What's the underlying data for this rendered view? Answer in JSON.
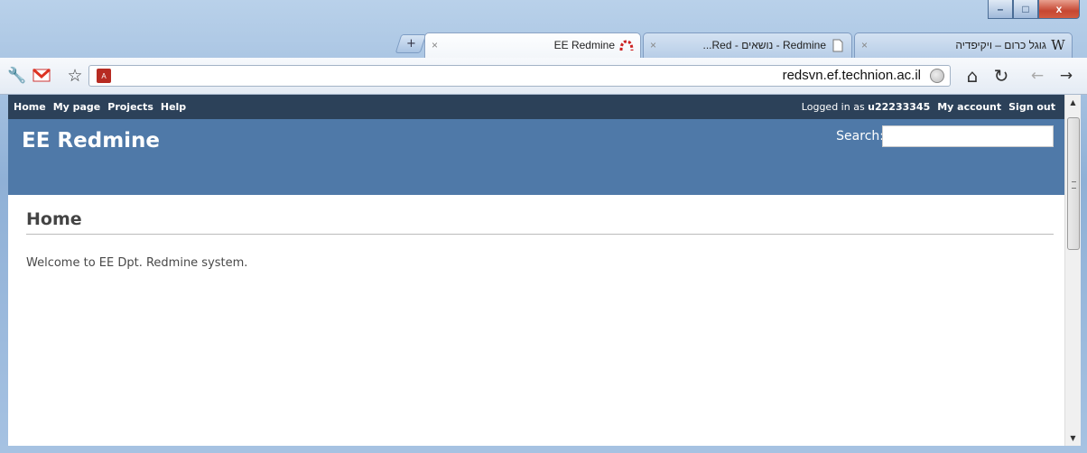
{
  "window": {
    "controls": {
      "minimize": "–",
      "maximize": "□",
      "close": "x"
    }
  },
  "tabs": [
    {
      "title": "EE Redmine",
      "active": true,
      "close": "×",
      "icon": "redmine-icon"
    },
    {
      "title": "...Red - נושאים - Redmine",
      "active": false,
      "close": "×",
      "icon": "page-icon"
    },
    {
      "title": "גוגל כרום – ויקיפדיה",
      "active": false,
      "close": "×",
      "icon": "wikipedia-icon",
      "icon_text": "W"
    }
  ],
  "toolbar": {
    "url": "redsvn.ef.technion.ac.il",
    "newtab": "+",
    "icons": [
      "wrench-icon",
      "gmail-icon",
      "star-icon",
      "acrobat-icon",
      "home-icon",
      "reload-icon",
      "back-icon",
      "forward-icon"
    ],
    "glyphs": {
      "wrench": "🔧",
      "star": "☆",
      "home": "⌂",
      "reload": "↻",
      "back": "←",
      "forward": "→",
      "acrobat": "A"
    }
  },
  "redmine": {
    "menu_left": [
      "Home",
      "My page",
      "Projects",
      "Help"
    ],
    "logged_in_prefix": "Logged in as",
    "user": "u22233345",
    "menu_right": [
      "My account",
      "Sign out"
    ],
    "site_title": "EE Redmine",
    "search_label": "Search:",
    "search_value": "",
    "page_heading": "Home",
    "welcome": "Welcome to EE Dpt. Redmine system."
  },
  "colors": {
    "topmenu": "#2c4159",
    "header": "#4f79a8"
  }
}
